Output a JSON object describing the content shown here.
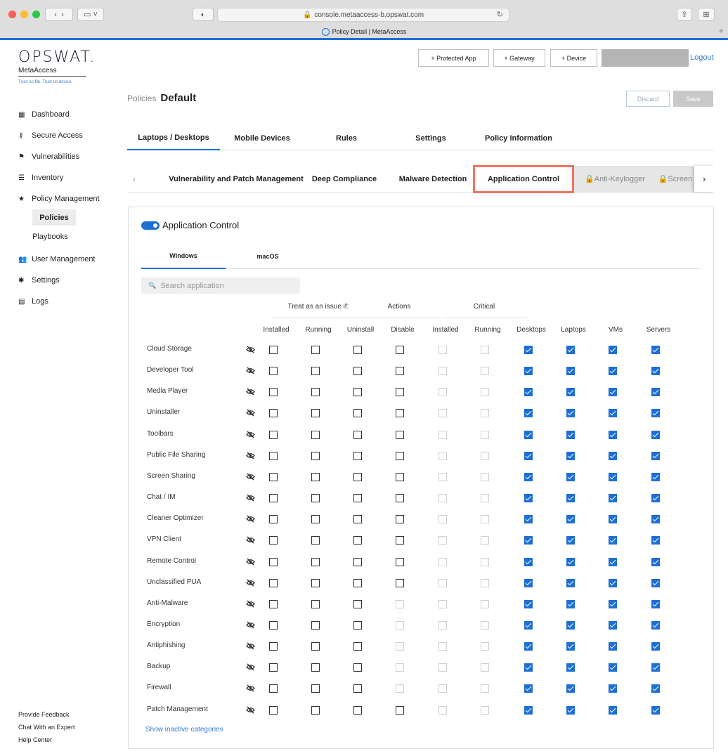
{
  "browser": {
    "url": "console.metaaccess-b.opswat.com",
    "tab_title": "Policy Detail | MetaAccess"
  },
  "brand": {
    "logo": "OPSWAT.",
    "product": "MetaAccess",
    "tagline": "Trust no file. Trust no device.",
    "accent": "#1d6fd6"
  },
  "sidebar": {
    "items": [
      {
        "label": "Dashboard",
        "icon": "grid-icon"
      },
      {
        "label": "Secure Access",
        "icon": "key-icon"
      },
      {
        "label": "Vulnerabilities",
        "icon": "flag-icon"
      },
      {
        "label": "Inventory",
        "icon": "list-icon"
      },
      {
        "label": "Policy Management",
        "icon": "star-icon"
      }
    ],
    "sub_items": [
      "Policies",
      "Playbooks"
    ],
    "items2": [
      {
        "label": "User Management",
        "icon": "users-icon"
      },
      {
        "label": "Settings",
        "icon": "gear-icon"
      },
      {
        "label": "Logs",
        "icon": "clipboard-icon"
      }
    ],
    "footer": [
      "Provide Feedback",
      "Chat With an Expert",
      "Help Center"
    ]
  },
  "header": {
    "buttons": [
      "+ Protected App",
      "+ Gateway",
      "+ Device"
    ],
    "logout": "Logout"
  },
  "breadcrumb": {
    "parent": "Policies",
    "current": "Default"
  },
  "actions": {
    "discard": "Discard",
    "save": "Save"
  },
  "primary_tabs": [
    "Laptops / Desktops",
    "Mobile Devices",
    "Rules",
    "Settings",
    "Policy Information"
  ],
  "secondary_tabs": [
    "Vulnerability and Patch Management",
    "Deep Compliance",
    "Malware Detection",
    "Application Control",
    "Anti-Keylogger",
    "Screen"
  ],
  "card": {
    "title": "Application Control",
    "enabled": true,
    "os_tabs": [
      "Windows",
      "macOS"
    ],
    "search_placeholder": "Search application",
    "groups": [
      "Treat as an issue if:",
      "Actions",
      "Critical"
    ],
    "columns": [
      "Installed",
      "Running",
      "Uninstall",
      "Disable",
      "Installed",
      "Running",
      "Desktops",
      "Laptops",
      "VMs",
      "Servers"
    ],
    "show_inactive": "Show inactive categories",
    "rows": [
      {
        "name": "Cloud Storage",
        "disable_enabled": true
      },
      {
        "name": "Developer Tool",
        "disable_enabled": true
      },
      {
        "name": "Media Player",
        "disable_enabled": true
      },
      {
        "name": "Uninstaller",
        "disable_enabled": true
      },
      {
        "name": "Toolbars",
        "disable_enabled": true
      },
      {
        "name": "Public File Sharing",
        "disable_enabled": true
      },
      {
        "name": "Screen Sharing",
        "disable_enabled": true
      },
      {
        "name": "Chat / IM",
        "disable_enabled": true
      },
      {
        "name": "Cleaner Optimizer",
        "disable_enabled": true
      },
      {
        "name": "VPN Client",
        "disable_enabled": true
      },
      {
        "name": "Remote Control",
        "disable_enabled": true
      },
      {
        "name": "Unclassified PUA",
        "disable_enabled": true
      },
      {
        "name": "Anti-Malware",
        "disable_enabled": false
      },
      {
        "name": "Encryption",
        "disable_enabled": false
      },
      {
        "name": "Antiphishing",
        "disable_enabled": false
      },
      {
        "name": "Backup",
        "disable_enabled": false
      },
      {
        "name": "Firewall",
        "disable_enabled": false
      },
      {
        "name": "Patch Management",
        "disable_enabled": true
      }
    ]
  }
}
